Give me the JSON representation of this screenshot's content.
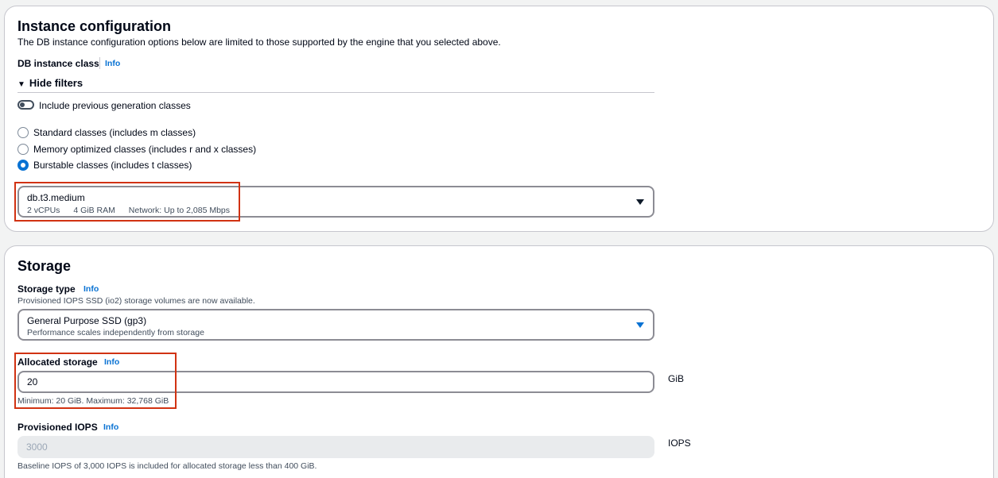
{
  "instance": {
    "title": "Instance configuration",
    "description": "The DB instance configuration options below are limited to those supported by the engine that you selected above.",
    "class_label": "DB instance class",
    "info": "Info",
    "filters_toggle": "Hide filters",
    "include_prev_label": "Include previous generation classes",
    "radios": [
      {
        "label": "Standard classes (includes m classes)",
        "checked": false
      },
      {
        "label": "Memory optimized classes (includes r and x classes)",
        "checked": false
      },
      {
        "label": "Burstable classes (includes t classes)",
        "checked": true
      }
    ],
    "selected_class": {
      "name": "db.t3.medium",
      "vcpu": "2 vCPUs",
      "ram": "4 GiB RAM",
      "network": "Network: Up to 2,085 Mbps"
    }
  },
  "storage": {
    "title": "Storage",
    "type_label": "Storage type",
    "info": "Info",
    "type_note": "Provisioned IOPS SSD (io2) storage volumes are now available.",
    "type_value": "General Purpose SSD (gp3)",
    "type_sub": "Performance scales independently from storage",
    "allocated_label": "Allocated storage",
    "allocated_value": "20",
    "allocated_unit": "GiB",
    "allocated_hint": "Minimum: 20 GiB. Maximum: 32,768 GiB",
    "iops_label": "Provisioned IOPS",
    "iops_value": "3000",
    "iops_unit": "IOPS",
    "iops_hint": "Baseline IOPS of 3,000 IOPS is included for allocated storage less than 400 GiB."
  },
  "colors": {
    "accent": "#0972d3",
    "highlight": "#d13212",
    "panel_border": "#c6c6cd"
  }
}
